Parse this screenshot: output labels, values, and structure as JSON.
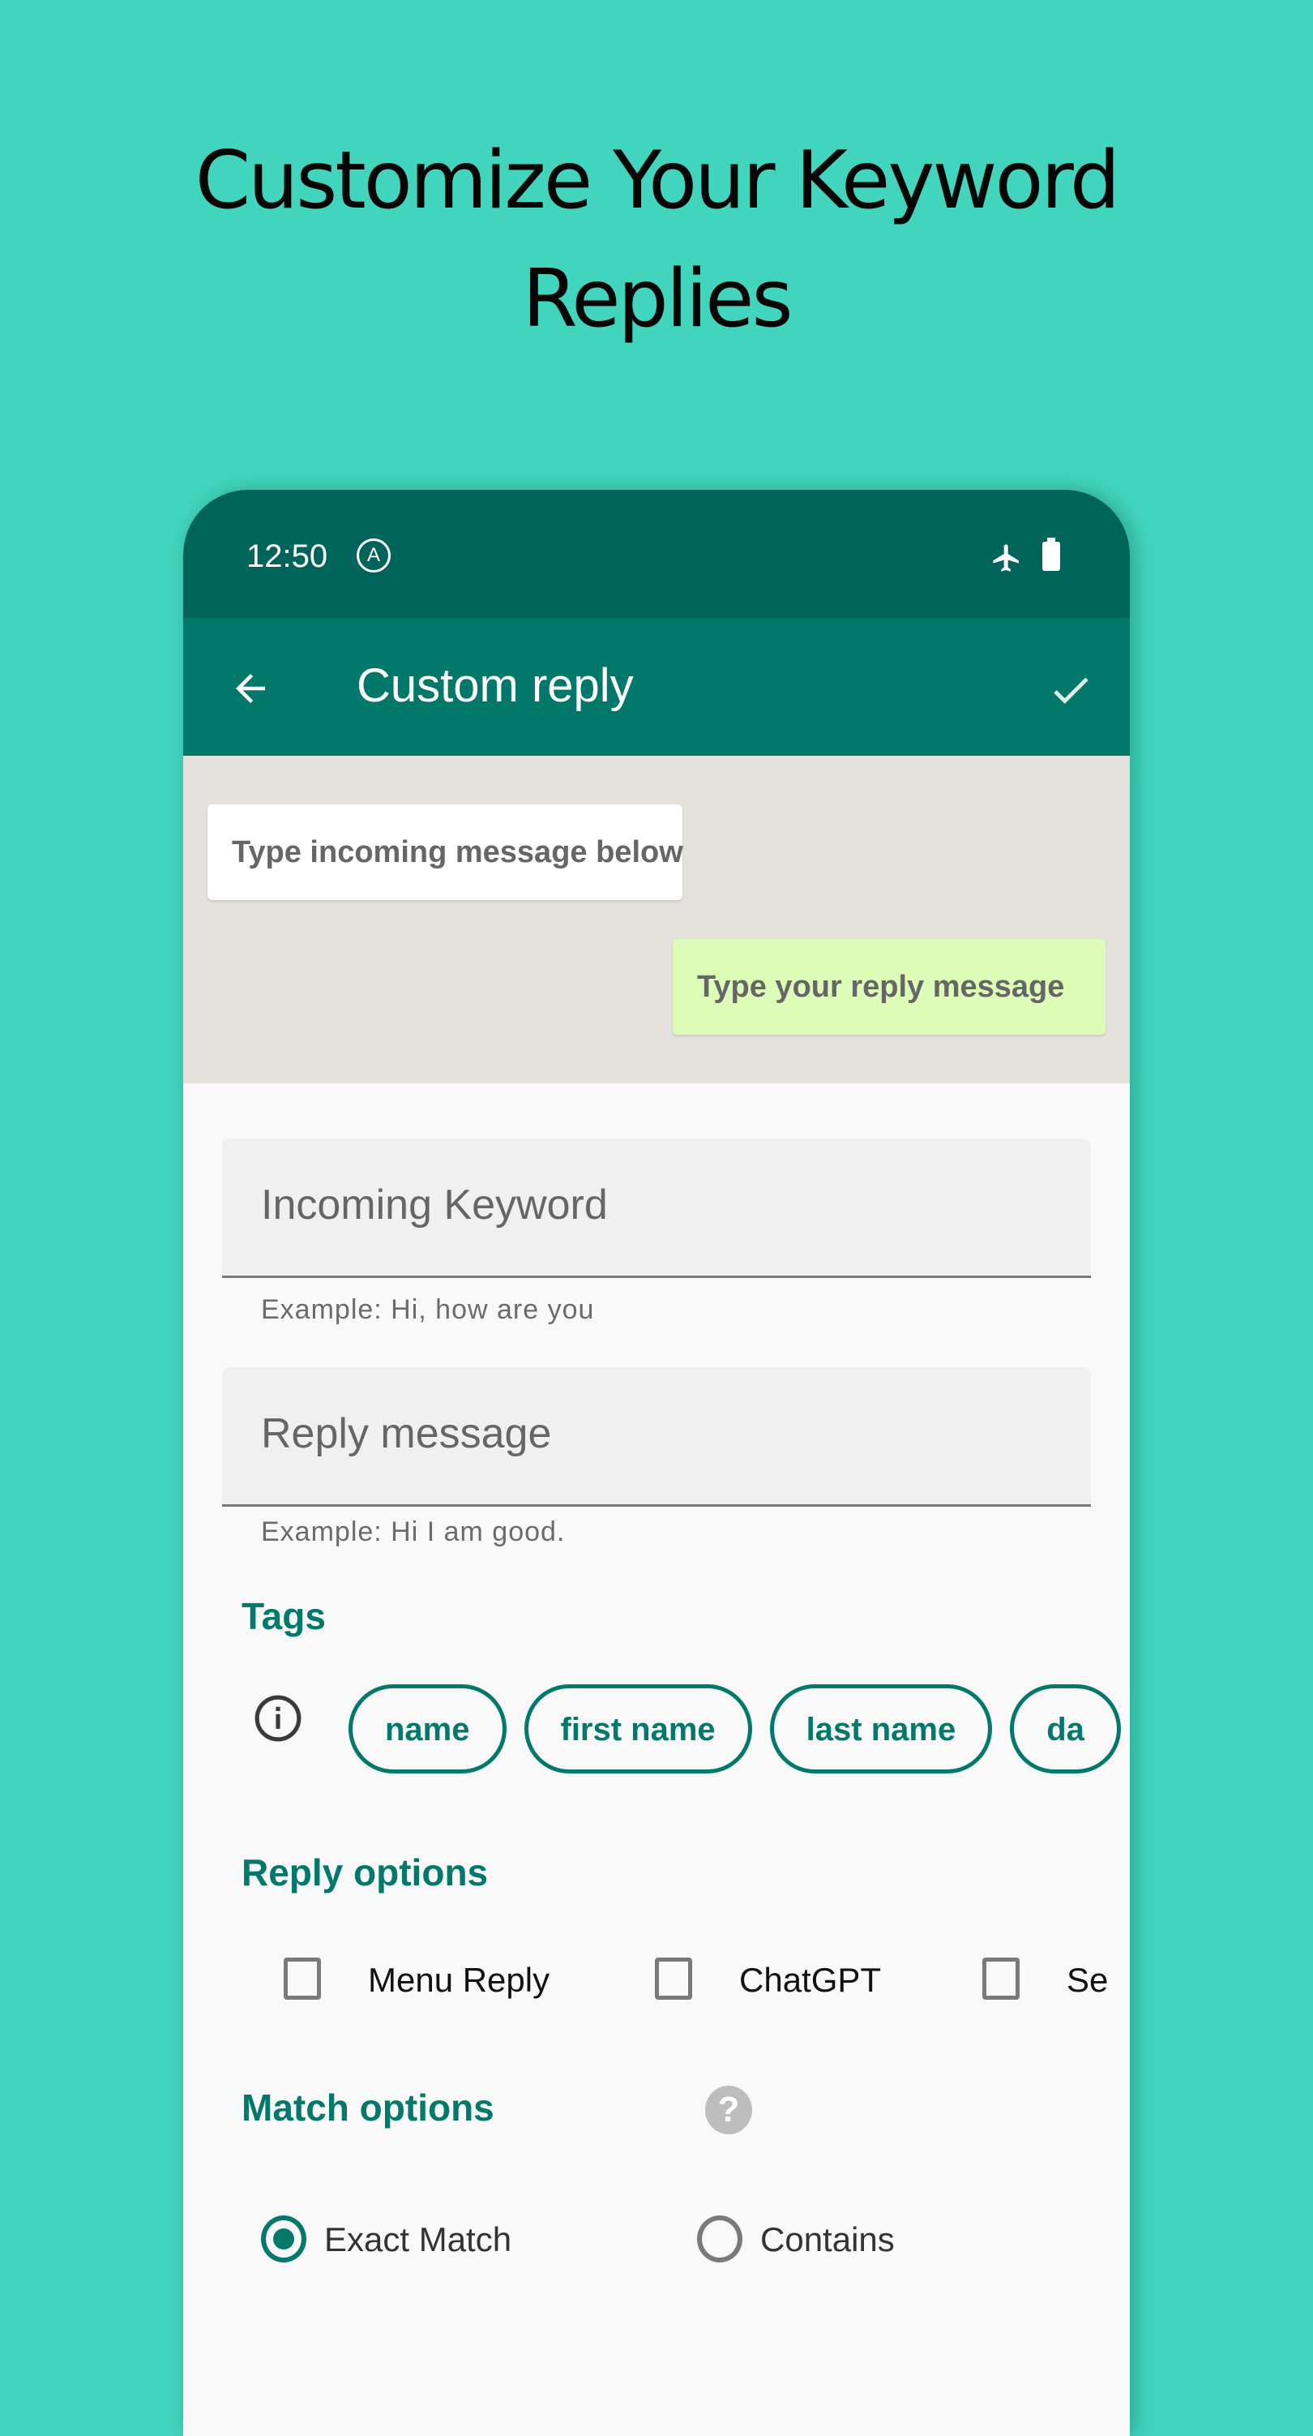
{
  "headline": {
    "line1": "Customize Your Keyword",
    "line2": "Replies"
  },
  "status_bar": {
    "time": "12:50",
    "indicator_letter": "A",
    "icons": [
      "airplane-mode-icon",
      "battery-icon"
    ]
  },
  "toolbar": {
    "title": "Custom reply",
    "back_icon": "arrow-left-icon",
    "confirm_icon": "check-icon"
  },
  "chat_preview": {
    "incoming_bubble": "Type incoming message below",
    "reply_bubble": "Type your reply message"
  },
  "fields": {
    "incoming_keyword": {
      "placeholder": "Incoming Keyword",
      "value": "",
      "helper": "Example: Hi, how are you"
    },
    "reply_message": {
      "placeholder": "Reply message",
      "value": "",
      "helper": "Example: Hi I am good."
    }
  },
  "tags": {
    "title": "Tags",
    "info_icon": "info-icon",
    "items": [
      "name",
      "first name",
      "last name",
      "da"
    ]
  },
  "reply_options": {
    "title": "Reply options",
    "items": [
      {
        "label": "Menu Reply",
        "checked": false
      },
      {
        "label": "ChatGPT",
        "checked": false
      },
      {
        "label": "Ser",
        "checked": false
      }
    ]
  },
  "match_options": {
    "title": "Match options",
    "help_icon": "help-icon",
    "help_glyph": "?",
    "items": [
      {
        "label": "Exact Match",
        "selected": true
      },
      {
        "label": "Contains",
        "selected": false
      }
    ]
  },
  "colors": {
    "background": "#42d5be",
    "status_bar": "#00645a",
    "toolbar": "#02786b",
    "accent": "#03796b",
    "chat_background": "#e5e2dd",
    "reply_bubble": "#dcfcb7"
  }
}
